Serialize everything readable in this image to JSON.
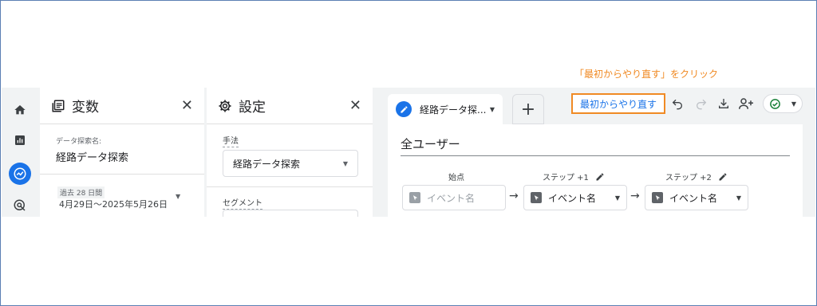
{
  "annotation": "「最初からやり直す」をクリック",
  "nav": {
    "items": [
      {
        "name": "home-icon"
      },
      {
        "name": "reports-icon"
      },
      {
        "name": "explore-icon"
      },
      {
        "name": "advertising-icon"
      }
    ]
  },
  "variables_panel": {
    "title": "変数",
    "exploration_name_label": "データ探索名:",
    "exploration_name": "経路データ探索",
    "date_chip": "過去 28 日間",
    "date_range": "4月29日〜2025年5月26日"
  },
  "settings_panel": {
    "title": "設定",
    "technique_label": "手法",
    "technique_value": "経路データ探索",
    "segment_label": "セグメント"
  },
  "tab": {
    "label": "経路データ探...",
    "add_label": "+"
  },
  "toolbar": {
    "restart_label": "最初からやり直す"
  },
  "canvas": {
    "segment_title": "全ユーザー",
    "start_label": "始点",
    "step1_label": "ステップ +1",
    "step2_label": "ステップ +2",
    "event_placeholder": "イベント名",
    "step1_value": "イベント名",
    "step2_value": "イベント名"
  },
  "colors": {
    "accent": "#1a73e8",
    "highlight": "#f08a24",
    "status_ok": "#188038"
  }
}
